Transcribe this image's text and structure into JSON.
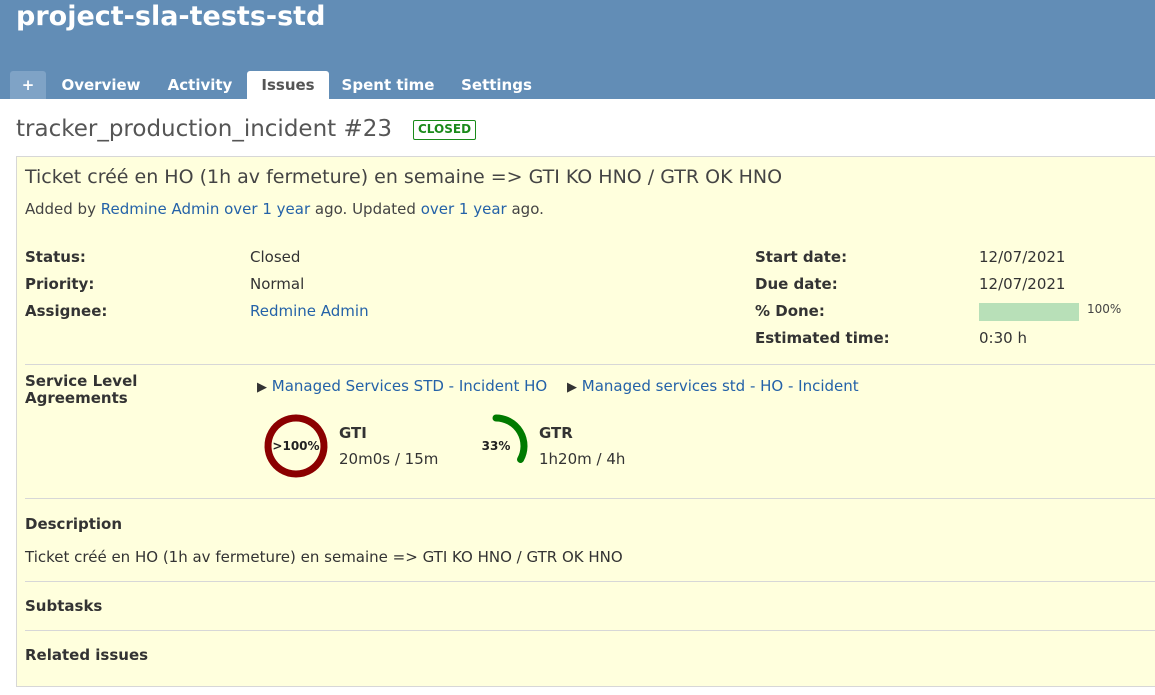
{
  "project": {
    "title": "project-sla-tests-std"
  },
  "menu": {
    "new_label": "+",
    "tabs": [
      "Overview",
      "Activity",
      "Issues",
      "Spent time",
      "Settings"
    ],
    "selected": "Issues"
  },
  "issue": {
    "heading": "tracker_production_incident #23",
    "status_badge": "CLOSED",
    "subject": "Ticket créé en HO (1h av fermeture) en semaine => GTI KO HNO / GTR OK HNO",
    "author_prefix": "Added by",
    "author": "Redmine Admin",
    "added_ago": "over 1 year",
    "ago_suffix": "ago. Updated",
    "updated_ago": "over 1 year",
    "ago_end": "ago.",
    "attributes": {
      "status_label": "Status:",
      "status_value": "Closed",
      "priority_label": "Priority:",
      "priority_value": "Normal",
      "assignee_label": "Assignee:",
      "assignee_value": "Redmine Admin",
      "start_label": "Start date:",
      "start_value": "12/07/2021",
      "due_label": "Due date:",
      "due_value": "12/07/2021",
      "done_label": "% Done:",
      "done_percent": 100,
      "done_text": "100%",
      "estimated_label": "Estimated time:",
      "estimated_value": "0:30 h"
    },
    "sla": {
      "label_line1": "Service Level",
      "label_line2": "Agreements",
      "links": [
        "Managed Services STD - Incident HO",
        "Managed services std - HO - Incident"
      ],
      "arrow": "▶",
      "gauges": [
        {
          "name": "GTI",
          "percent_label": ">100%",
          "fraction": 1.0,
          "value": "20m0s / 15m",
          "color": "#8b0000"
        },
        {
          "name": "GTR",
          "percent_label": "33%",
          "fraction": 0.33,
          "value": "1h20m / 4h",
          "color": "#007a00"
        }
      ]
    },
    "description_label": "Description",
    "description_text": "Ticket créé en HO (1h av fermeture) en semaine => GTI KO HNO / GTR OK HNO",
    "subtasks_label": "Subtasks",
    "related_label": "Related issues"
  }
}
